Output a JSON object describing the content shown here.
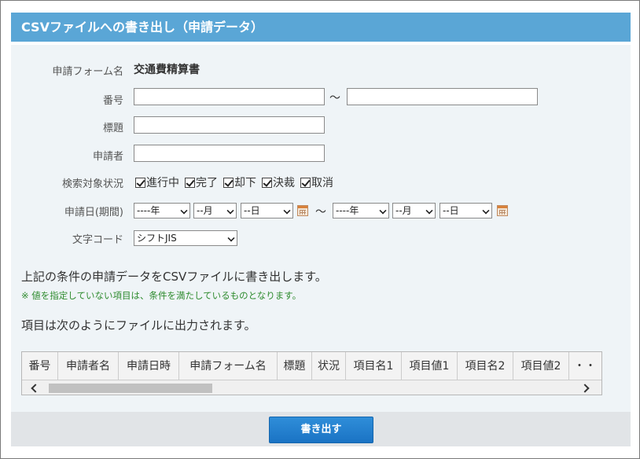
{
  "title": "CSVファイルへの書き出し（申請データ）",
  "form": {
    "form_name_label": "申請フォーム名",
    "form_name_value": "交通費精算書",
    "number_label": "番号",
    "number_from": "",
    "number_to": "",
    "tilde": "〜",
    "subject_label": "標題",
    "subject_value": "",
    "applicant_label": "申請者",
    "applicant_value": "",
    "status_label": "検索対象状況",
    "statuses": [
      "進行中",
      "完了",
      "却下",
      "決裁",
      "取消"
    ],
    "date_label": "申請日(期間)",
    "date_from": {
      "year": "----年",
      "month": "--月",
      "day": "--日"
    },
    "date_to": {
      "year": "----年",
      "month": "--月",
      "day": "--日"
    },
    "charset_label": "文字コード",
    "charset_value": "シフトJIS"
  },
  "description": "上記の条件の申請データをCSVファイルに書き出します。",
  "note": "※ 値を指定していない項目は、条件を満たしているものとなります。",
  "output_description": "項目は次のようにファイルに出力されます。",
  "columns": [
    "番号",
    "申請者名",
    "申請日時",
    "申請フォーム名",
    "標題",
    "状況",
    "項目名1",
    "項目値1",
    "項目名2",
    "項目値2",
    "・・"
  ],
  "export_button": "書き出す"
}
